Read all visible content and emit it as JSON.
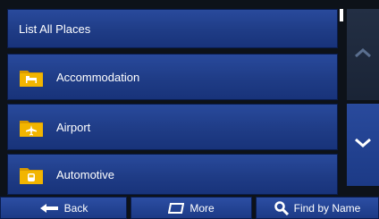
{
  "header": {
    "title": "List All Places"
  },
  "categories": [
    {
      "label": "Accommodation",
      "icon": "bed-icon"
    },
    {
      "label": "Airport",
      "icon": "airplane-icon"
    },
    {
      "label": "Automotive",
      "icon": "car-icon"
    }
  ],
  "toolbar": {
    "back_label": "Back",
    "more_label": "More",
    "find_label": "Find by Name"
  },
  "colors": {
    "row": "#1f3c86",
    "folder": "#f2b500",
    "background": "#0d1219"
  }
}
